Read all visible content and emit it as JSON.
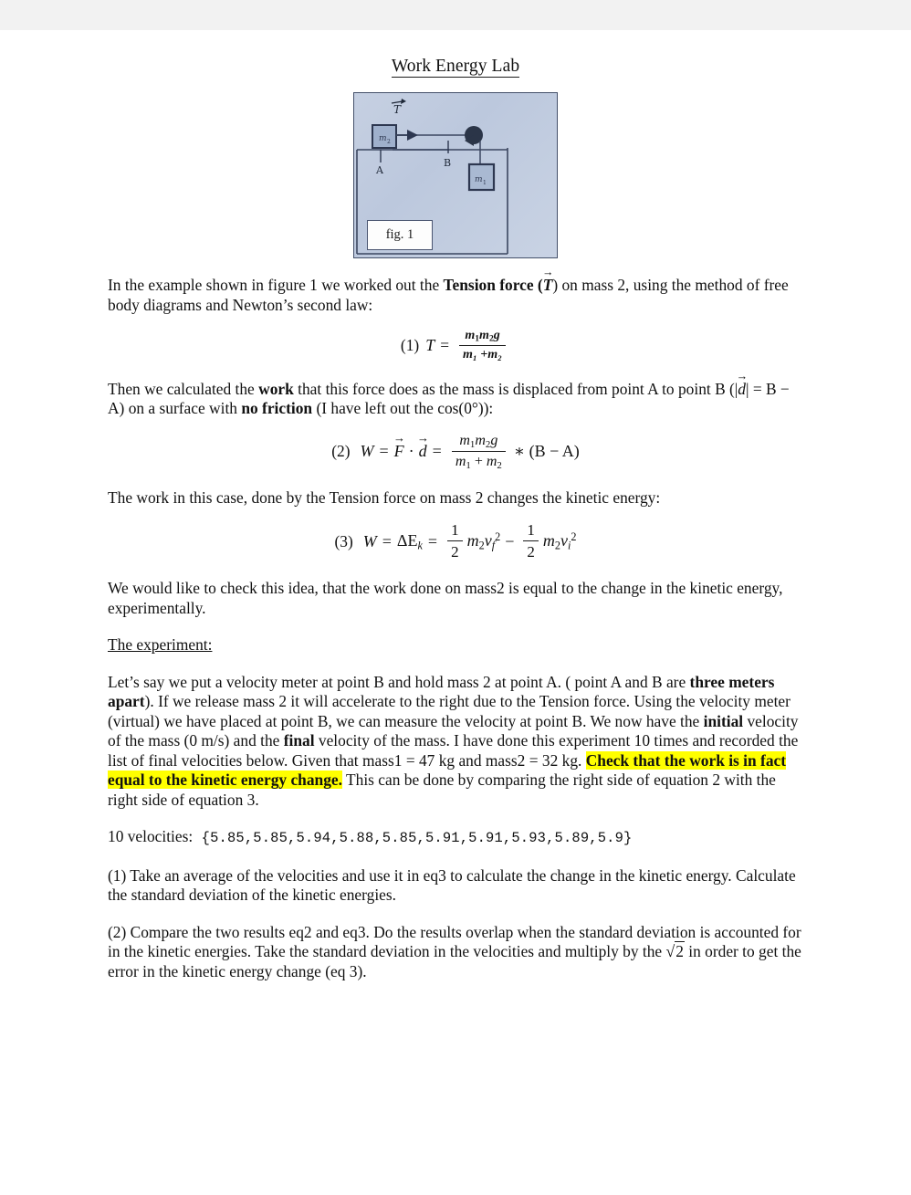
{
  "document": {
    "title": "Work Energy Lab",
    "figure": {
      "caption": "fig. 1",
      "label_tension": "T",
      "label_mass_on_table": "m2",
      "label_hanging_mass": "m1",
      "label_point_a": "A",
      "label_point_b": "B",
      "background_color": "#c3cde0",
      "stroke_color": "#3b4660"
    },
    "paragraphs": {
      "intro_1": "In the example shown in figure 1 we worked out the ",
      "intro_bold": "Tension force",
      "intro_vec_open": " (",
      "intro_vec_sym": "T",
      "intro_2": ") on mass 2, using the method of free body diagrams and Newton’s second law:",
      "work_1": "Then we calculated the ",
      "work_bold": "work",
      "work_2": " that this force does as the mass is displaced from point A to point B  (|",
      "work_d": "d",
      "work_3": "| = B − A) on a surface with ",
      "work_bold2": "no friction",
      "work_4": " (I have left out the cos(0°)):",
      "kinetic": "The work in this case, done by the Tension force on mass 2 changes the kinetic energy:",
      "check_idea": "We would like to check this idea, that the work done on mass2 is equal to the change in the kinetic energy, experimentally.",
      "experiment_heading": "The experiment:",
      "exp_1": "Let’s say we put a velocity meter at point B and hold mass 2 at point A. ( point A and B are ",
      "exp_bold_1": "three meters apart",
      "exp_2": "). If we release mass 2 it will accelerate to the right due to the Tension force. Using the velocity meter (virtual) we have placed at point B, we can measure the velocity at point B. We now have the ",
      "exp_bold_2": "initial",
      "exp_3": " velocity of the mass (0 m/s) and the ",
      "exp_bold_3": "final",
      "exp_4": " velocity of the mass. I have done this experiment 10 times and recorded the list of final velocities below. Given that mass1 = 47 kg and mass2 = 32 kg. ",
      "exp_highlight": "Check that the work is in fact equal to the kinetic energy change.",
      "exp_5": " This can be done by comparing the right side of equation 2 with the right side of equation 3.",
      "task_1": "(1) Take an average of the velocities and use it in eq3 to calculate the change in the kinetic energy. Calculate the standard deviation of the kinetic energies.",
      "task_2_a": "(2) Compare the two results eq2 and eq3. Do the results overlap when the standard deviation is accounted for in the kinetic energies. Take the standard deviation in the velocities and multiply by the ",
      "task_2_sqrt": "2",
      "task_2_b": " in order to get the error in the kinetic energy change (eq 3)."
    },
    "equations": {
      "eq1": {
        "number": "(1)",
        "lhs": "T",
        "equals": "=",
        "numerator_m1": "m",
        "numerator_m1_sub": "1",
        "numerator_m2": "m",
        "numerator_m2_sub": "2",
        "numerator_g": "g",
        "denominator": "m₁ +m₂"
      },
      "eq2": {
        "number": "(2)",
        "lhs": "W",
        "rhs_force": "F",
        "dot": "·",
        "rhs_disp": "d",
        "tail": "∗ (B − A)"
      },
      "eq3": {
        "number": "(3)",
        "lhs": "W",
        "delta_ek": "ΔE",
        "delta_ek_sub": "k",
        "half": "1",
        "half_den": "2",
        "mass_sym": "m",
        "mass_sub": "2",
        "v_final": "v",
        "v_final_sub": "f",
        "v_initial": "v",
        "v_initial_sub": "i",
        "exponent": "2",
        "minus": "−"
      }
    },
    "velocities": {
      "label": "10 velocities:",
      "open_brace": "{",
      "values": "5.85,5.85,5.94,5.88,5.85,5.91,5.91,5.93,5.89,5.9",
      "close_brace": "}",
      "count": 10,
      "list": [
        5.85,
        5.85,
        5.94,
        5.88,
        5.85,
        5.91,
        5.91,
        5.93,
        5.89,
        5.9
      ]
    },
    "given_values": {
      "mass1_kg": 47,
      "mass2_kg": 32,
      "distance_m": 3,
      "initial_velocity_ms": 0
    },
    "colors": {
      "highlight": "#ffff00",
      "text": "#111111",
      "top_band": "#f2f2f2"
    }
  }
}
